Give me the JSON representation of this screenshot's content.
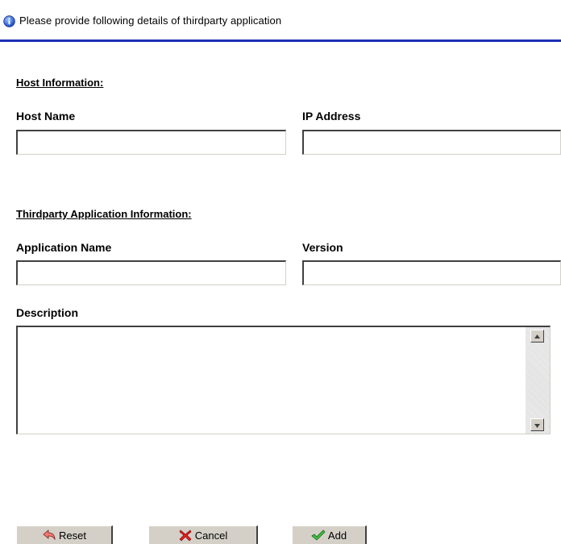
{
  "header": {
    "message": "Please provide following details of thirdparty application",
    "icon": "info-icon"
  },
  "host_section": {
    "title": "Host Information:",
    "host_name_label": "Host Name",
    "host_name_value": "",
    "ip_address_label": "IP Address",
    "ip_address_value": ""
  },
  "app_section": {
    "title": "Thirdparty Application Information:",
    "app_name_label": "Application Name",
    "app_name_value": "",
    "version_label": "Version",
    "version_value": "",
    "description_label": "Description",
    "description_value": ""
  },
  "buttons": {
    "reset_label": "Reset",
    "reset_icon": "undo-arrow-icon",
    "cancel_label": "Cancel",
    "cancel_icon": "red-x-icon",
    "add_label": "Add",
    "add_icon": "green-check-icon"
  },
  "colors": {
    "header_rule": "#1d2fb5",
    "button_face": "#d4d0c8",
    "info_icon": "#2a5bd7"
  }
}
